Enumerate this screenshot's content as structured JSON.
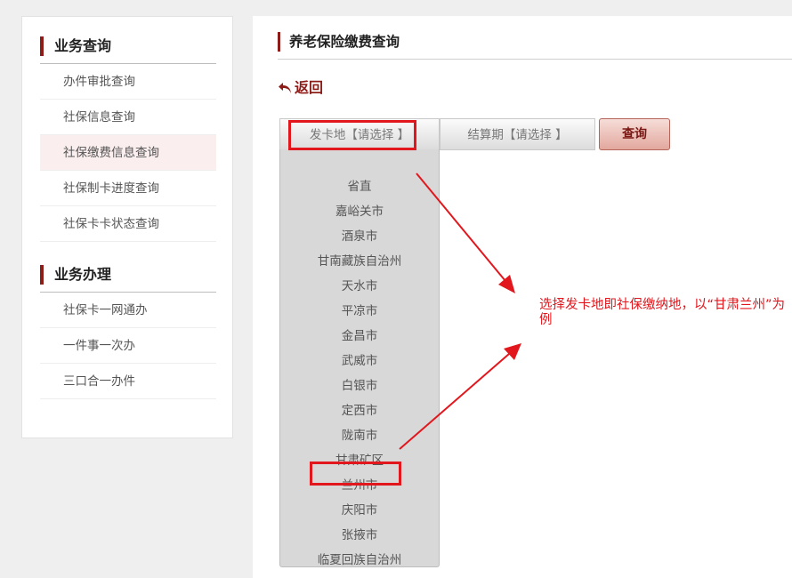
{
  "sidebar": {
    "sections": [
      {
        "title": "业务查询",
        "items": [
          "办件审批查询",
          "社保信息查询",
          "社保缴费信息查询",
          "社保制卡进度查询",
          "社保卡卡状态查询"
        ]
      },
      {
        "title": "业务办理",
        "items": [
          "社保卡一网通办",
          "一件事一次办",
          "三口合一办件"
        ]
      }
    ],
    "active_item": "社保缴费信息查询"
  },
  "main": {
    "page_title": "养老保险缴费查询",
    "back_label": "返回",
    "card_location_select": "发卡地【请选择 】",
    "period_select": "结算期【请选择 】",
    "query_button": "查询",
    "dropdown_options": [
      "省直",
      "嘉峪关市",
      "酒泉市",
      "甘南藏族自治州",
      "天水市",
      "平凉市",
      "金昌市",
      "武威市",
      "白银市",
      "定西市",
      "陇南市",
      "甘肃矿区",
      "兰州市",
      "庆阳市",
      "张掖市",
      "临夏回族自治州"
    ],
    "highlighted_option": "兰州市"
  },
  "annotation": {
    "text": "选择发卡地即社保缴纳地，以“甘肃兰州”为例",
    "color": "#e2171d"
  },
  "colors": {
    "accent": "#8c1d18",
    "active_bg": "#fbeeee",
    "highlight": "#e2171d"
  }
}
